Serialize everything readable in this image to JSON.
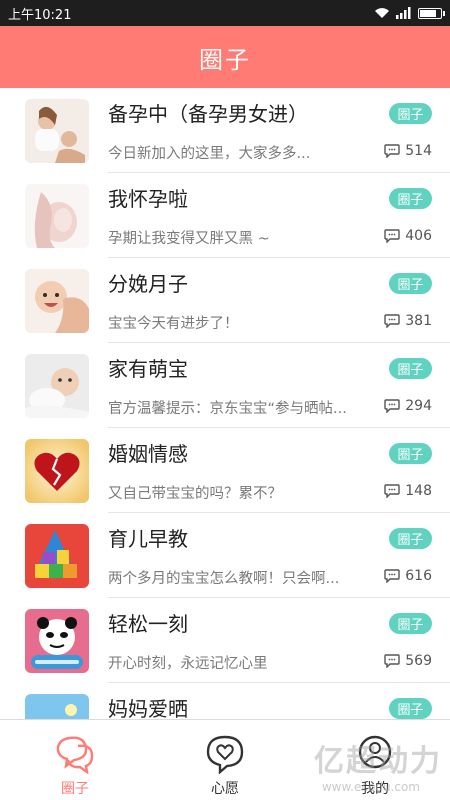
{
  "status_bar": {
    "time": "上午10:21"
  },
  "header": {
    "title": "圈子"
  },
  "circles": [
    {
      "name": "备孕中（备孕男女进）",
      "desc": "今日新加入的这里，大家多多...",
      "tag": "圈子",
      "count": "514",
      "thumb": "couple-photo"
    },
    {
      "name": "我怀孕啦",
      "desc": "孕期让我变得又胖又黑 ~",
      "tag": "圈子",
      "count": "406",
      "thumb": "pregnant-belly-photo"
    },
    {
      "name": "分娩月子",
      "desc": "宝宝今天有进步了！",
      "tag": "圈子",
      "count": "381",
      "thumb": "mother-baby-photo"
    },
    {
      "name": "家有萌宝",
      "desc": "官方温馨提示：京东宝宝“参与晒帖...",
      "tag": "圈子",
      "count": "294",
      "thumb": "baby-photo"
    },
    {
      "name": "婚姻情感",
      "desc": "又自己带宝宝的吗？累不？",
      "tag": "圈子",
      "count": "148",
      "thumb": "broken-heart-image"
    },
    {
      "name": "育儿早教",
      "desc": "两个多月的宝宝怎么教啊！只会啊...",
      "tag": "圈子",
      "count": "616",
      "thumb": "toy-blocks-image"
    },
    {
      "name": "轻松一刻",
      "desc": "开心时刻，永远记忆心里",
      "tag": "圈子",
      "count": "569",
      "thumb": "panda-meme-image"
    },
    {
      "name": "妈妈爱晒",
      "desc": "",
      "tag": "圈子",
      "count": "",
      "thumb": "landscape-image"
    }
  ],
  "tabs": [
    {
      "label": "圈子",
      "icon": "chat-bubble-icon",
      "active": true
    },
    {
      "label": "心愿",
      "icon": "heart-bubble-icon",
      "active": false
    },
    {
      "label": "我的",
      "icon": "profile-icon",
      "active": false
    }
  ],
  "watermark": {
    "text": "亿超动力",
    "sub": "www.ecodu.com"
  },
  "colors": {
    "accent": "#ff7b74",
    "tag": "#5fd3c0",
    "status_bar": "#1e1e1e"
  }
}
